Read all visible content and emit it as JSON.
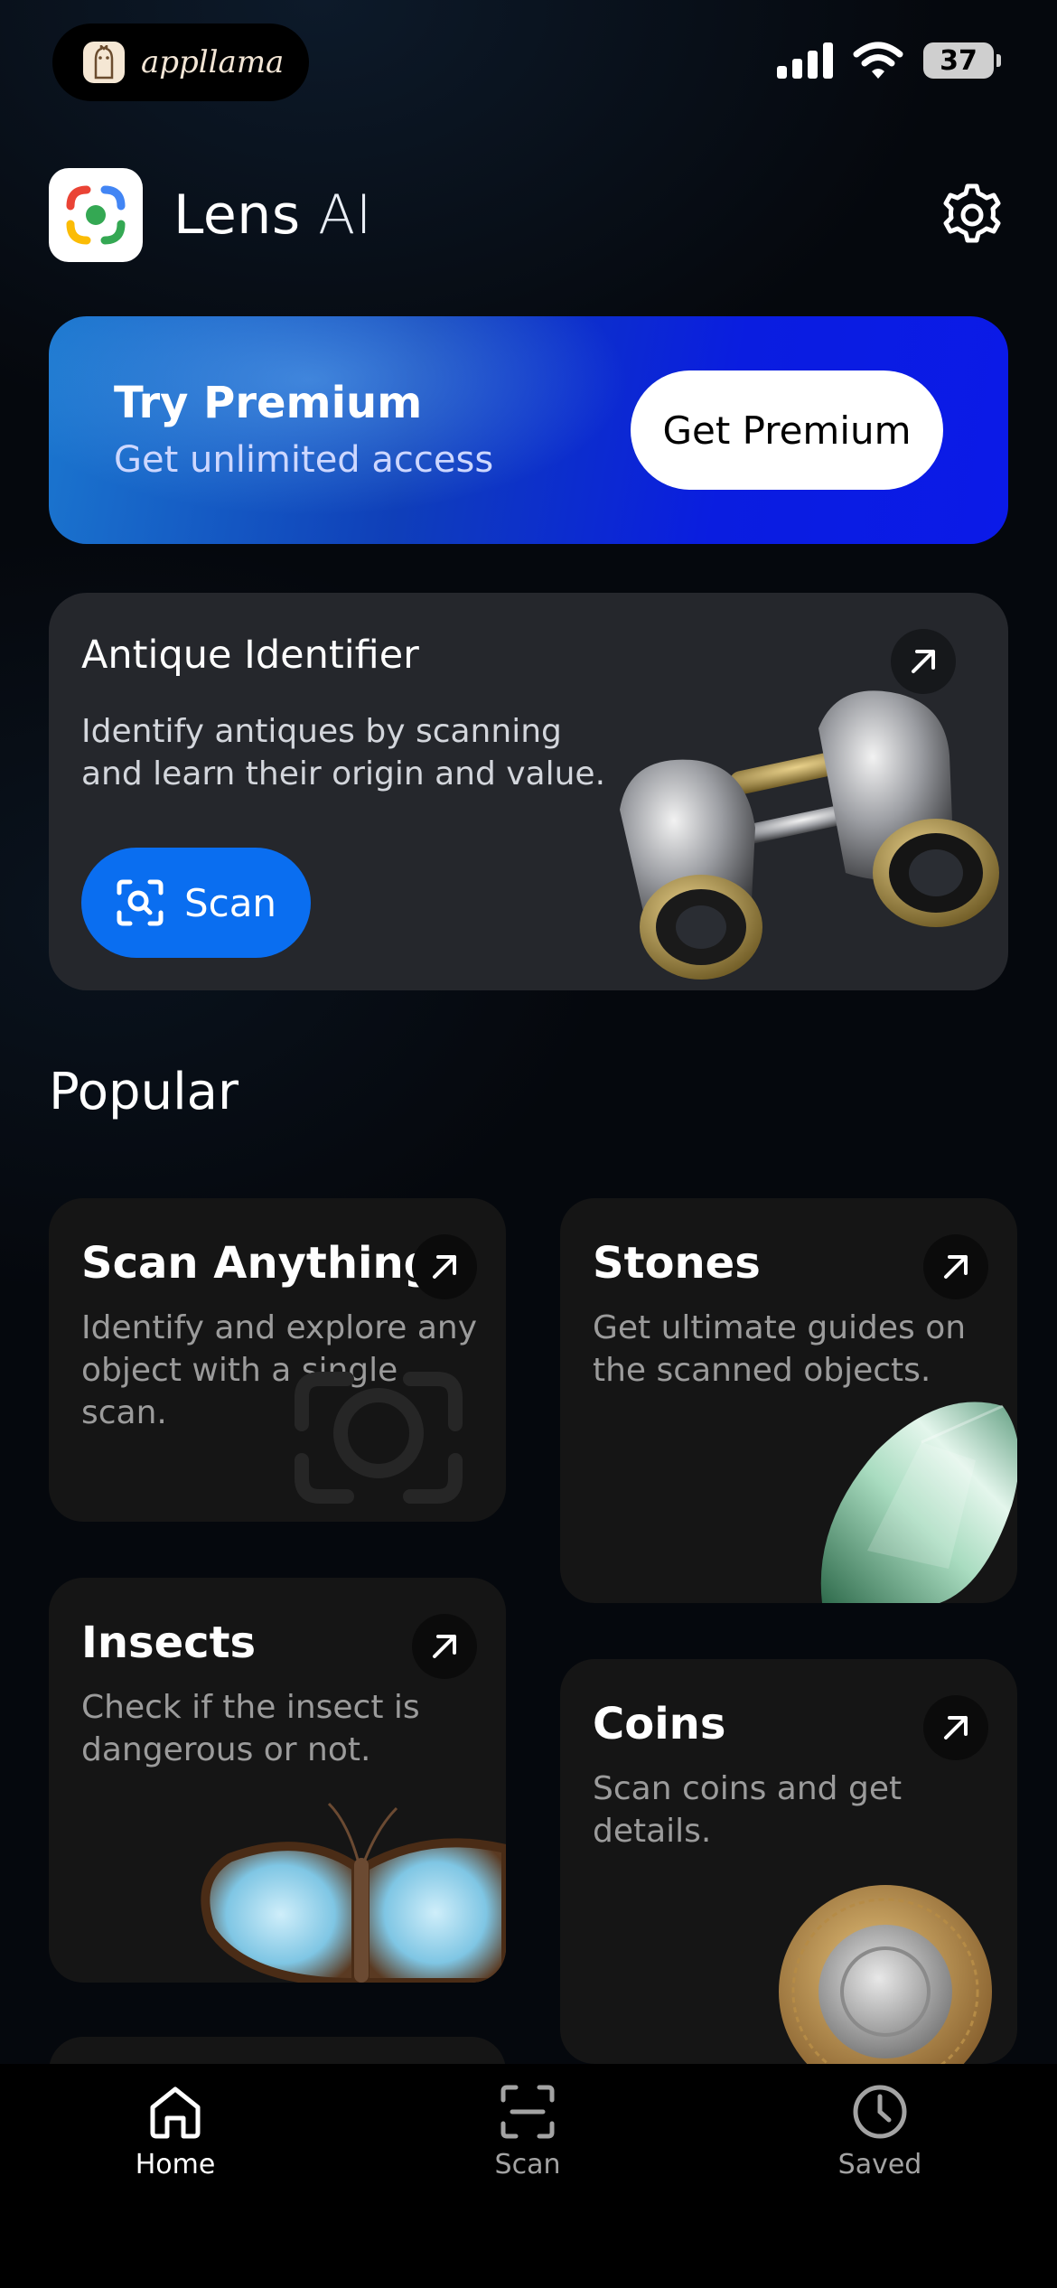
{
  "status_bar": {
    "app_pill_text": "appllama",
    "battery": "37"
  },
  "header": {
    "title_main": "Lens",
    "title_suffix": "AI",
    "settings_icon": "gear-icon"
  },
  "premium": {
    "title": "Try Premium",
    "subtitle": "Get unlimited access",
    "button_label": "Get Premium"
  },
  "featured": {
    "title": "Antique Identifier",
    "description": "Identify antiques by scanning and learn their origin and value.",
    "scan_label": "Scan"
  },
  "popular": {
    "heading": "Popular",
    "cards": [
      {
        "title": "Scan Anything",
        "description": "Identify and explore any object with a single scan."
      },
      {
        "title": "Stones",
        "description": "Get ultimate guides on the scanned objects."
      },
      {
        "title": "Insects",
        "description": "Check if the insect is dangerous or not."
      },
      {
        "title": "Coins",
        "description": "Scan coins and get details."
      }
    ]
  },
  "tabbar": {
    "items": [
      {
        "label": "Home",
        "icon": "home-icon",
        "active": true
      },
      {
        "label": "Scan",
        "icon": "scan-icon",
        "active": false
      },
      {
        "label": "Saved",
        "icon": "clock-icon",
        "active": false
      }
    ]
  },
  "colors": {
    "background": "#05080d",
    "accent_blue": "#0a6ef0",
    "card": "#151515",
    "featured_card": "#25272c"
  }
}
